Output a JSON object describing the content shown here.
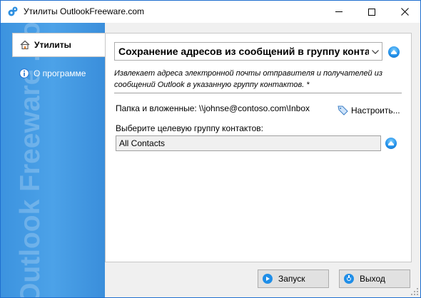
{
  "window": {
    "title": "Утилиты OutlookFreeware.com"
  },
  "sidebar": {
    "watermark": "Outlook Freeware .com",
    "tabs": [
      {
        "label": "Утилиты",
        "icon": "home-icon",
        "active": true
      },
      {
        "label": "О программе",
        "icon": "info-icon",
        "active": false
      }
    ]
  },
  "main": {
    "utility_select": {
      "value": "Сохранение адресов из сообщений в группу контактов"
    },
    "description": "Извлекает адреса электронной почты отправителя и получателей из сообщений Outlook в указанную группу контактов. *",
    "folder_label": "Папка и вложенные: \\\\johnse@contoso.com\\Inbox",
    "settings_label": "Настроить...",
    "group_label": "Выберите целевую группу контактов:",
    "group_value": "All Contacts"
  },
  "footer": {
    "start_label": "Запуск",
    "exit_label": "Выход"
  },
  "colors": {
    "accent": "#1f6fd0",
    "sidebar": "#4ca2e8",
    "icon_blue": "#1f8ee8"
  }
}
